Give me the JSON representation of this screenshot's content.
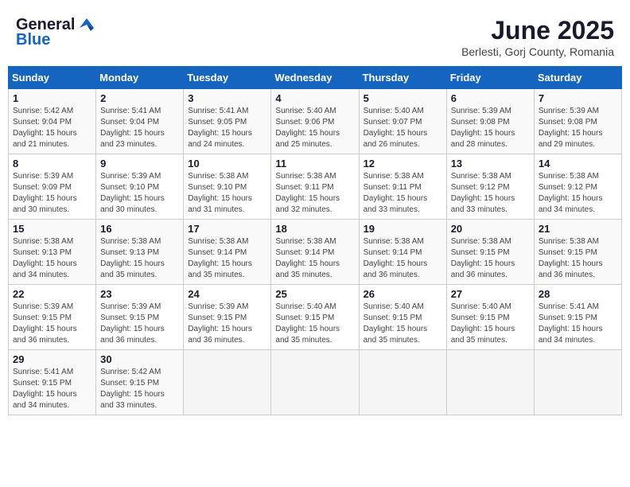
{
  "logo": {
    "general": "General",
    "blue": "Blue"
  },
  "title": "June 2025",
  "subtitle": "Berlesti, Gorj County, Romania",
  "weekdays": [
    "Sunday",
    "Monday",
    "Tuesday",
    "Wednesday",
    "Thursday",
    "Friday",
    "Saturday"
  ],
  "weeks": [
    [
      {
        "day": "1",
        "info": "Sunrise: 5:42 AM\nSunset: 9:04 PM\nDaylight: 15 hours\nand 21 minutes."
      },
      {
        "day": "2",
        "info": "Sunrise: 5:41 AM\nSunset: 9:04 PM\nDaylight: 15 hours\nand 23 minutes."
      },
      {
        "day": "3",
        "info": "Sunrise: 5:41 AM\nSunset: 9:05 PM\nDaylight: 15 hours\nand 24 minutes."
      },
      {
        "day": "4",
        "info": "Sunrise: 5:40 AM\nSunset: 9:06 PM\nDaylight: 15 hours\nand 25 minutes."
      },
      {
        "day": "5",
        "info": "Sunrise: 5:40 AM\nSunset: 9:07 PM\nDaylight: 15 hours\nand 26 minutes."
      },
      {
        "day": "6",
        "info": "Sunrise: 5:39 AM\nSunset: 9:08 PM\nDaylight: 15 hours\nand 28 minutes."
      },
      {
        "day": "7",
        "info": "Sunrise: 5:39 AM\nSunset: 9:08 PM\nDaylight: 15 hours\nand 29 minutes."
      }
    ],
    [
      {
        "day": "8",
        "info": "Sunrise: 5:39 AM\nSunset: 9:09 PM\nDaylight: 15 hours\nand 30 minutes."
      },
      {
        "day": "9",
        "info": "Sunrise: 5:39 AM\nSunset: 9:10 PM\nDaylight: 15 hours\nand 30 minutes."
      },
      {
        "day": "10",
        "info": "Sunrise: 5:38 AM\nSunset: 9:10 PM\nDaylight: 15 hours\nand 31 minutes."
      },
      {
        "day": "11",
        "info": "Sunrise: 5:38 AM\nSunset: 9:11 PM\nDaylight: 15 hours\nand 32 minutes."
      },
      {
        "day": "12",
        "info": "Sunrise: 5:38 AM\nSunset: 9:11 PM\nDaylight: 15 hours\nand 33 minutes."
      },
      {
        "day": "13",
        "info": "Sunrise: 5:38 AM\nSunset: 9:12 PM\nDaylight: 15 hours\nand 33 minutes."
      },
      {
        "day": "14",
        "info": "Sunrise: 5:38 AM\nSunset: 9:12 PM\nDaylight: 15 hours\nand 34 minutes."
      }
    ],
    [
      {
        "day": "15",
        "info": "Sunrise: 5:38 AM\nSunset: 9:13 PM\nDaylight: 15 hours\nand 34 minutes."
      },
      {
        "day": "16",
        "info": "Sunrise: 5:38 AM\nSunset: 9:13 PM\nDaylight: 15 hours\nand 35 minutes."
      },
      {
        "day": "17",
        "info": "Sunrise: 5:38 AM\nSunset: 9:14 PM\nDaylight: 15 hours\nand 35 minutes."
      },
      {
        "day": "18",
        "info": "Sunrise: 5:38 AM\nSunset: 9:14 PM\nDaylight: 15 hours\nand 35 minutes."
      },
      {
        "day": "19",
        "info": "Sunrise: 5:38 AM\nSunset: 9:14 PM\nDaylight: 15 hours\nand 36 minutes."
      },
      {
        "day": "20",
        "info": "Sunrise: 5:38 AM\nSunset: 9:15 PM\nDaylight: 15 hours\nand 36 minutes."
      },
      {
        "day": "21",
        "info": "Sunrise: 5:38 AM\nSunset: 9:15 PM\nDaylight: 15 hours\nand 36 minutes."
      }
    ],
    [
      {
        "day": "22",
        "info": "Sunrise: 5:39 AM\nSunset: 9:15 PM\nDaylight: 15 hours\nand 36 minutes."
      },
      {
        "day": "23",
        "info": "Sunrise: 5:39 AM\nSunset: 9:15 PM\nDaylight: 15 hours\nand 36 minutes."
      },
      {
        "day": "24",
        "info": "Sunrise: 5:39 AM\nSunset: 9:15 PM\nDaylight: 15 hours\nand 36 minutes."
      },
      {
        "day": "25",
        "info": "Sunrise: 5:40 AM\nSunset: 9:15 PM\nDaylight: 15 hours\nand 35 minutes."
      },
      {
        "day": "26",
        "info": "Sunrise: 5:40 AM\nSunset: 9:15 PM\nDaylight: 15 hours\nand 35 minutes."
      },
      {
        "day": "27",
        "info": "Sunrise: 5:40 AM\nSunset: 9:15 PM\nDaylight: 15 hours\nand 35 minutes."
      },
      {
        "day": "28",
        "info": "Sunrise: 5:41 AM\nSunset: 9:15 PM\nDaylight: 15 hours\nand 34 minutes."
      }
    ],
    [
      {
        "day": "29",
        "info": "Sunrise: 5:41 AM\nSunset: 9:15 PM\nDaylight: 15 hours\nand 34 minutes."
      },
      {
        "day": "30",
        "info": "Sunrise: 5:42 AM\nSunset: 9:15 PM\nDaylight: 15 hours\nand 33 minutes."
      },
      null,
      null,
      null,
      null,
      null
    ]
  ]
}
